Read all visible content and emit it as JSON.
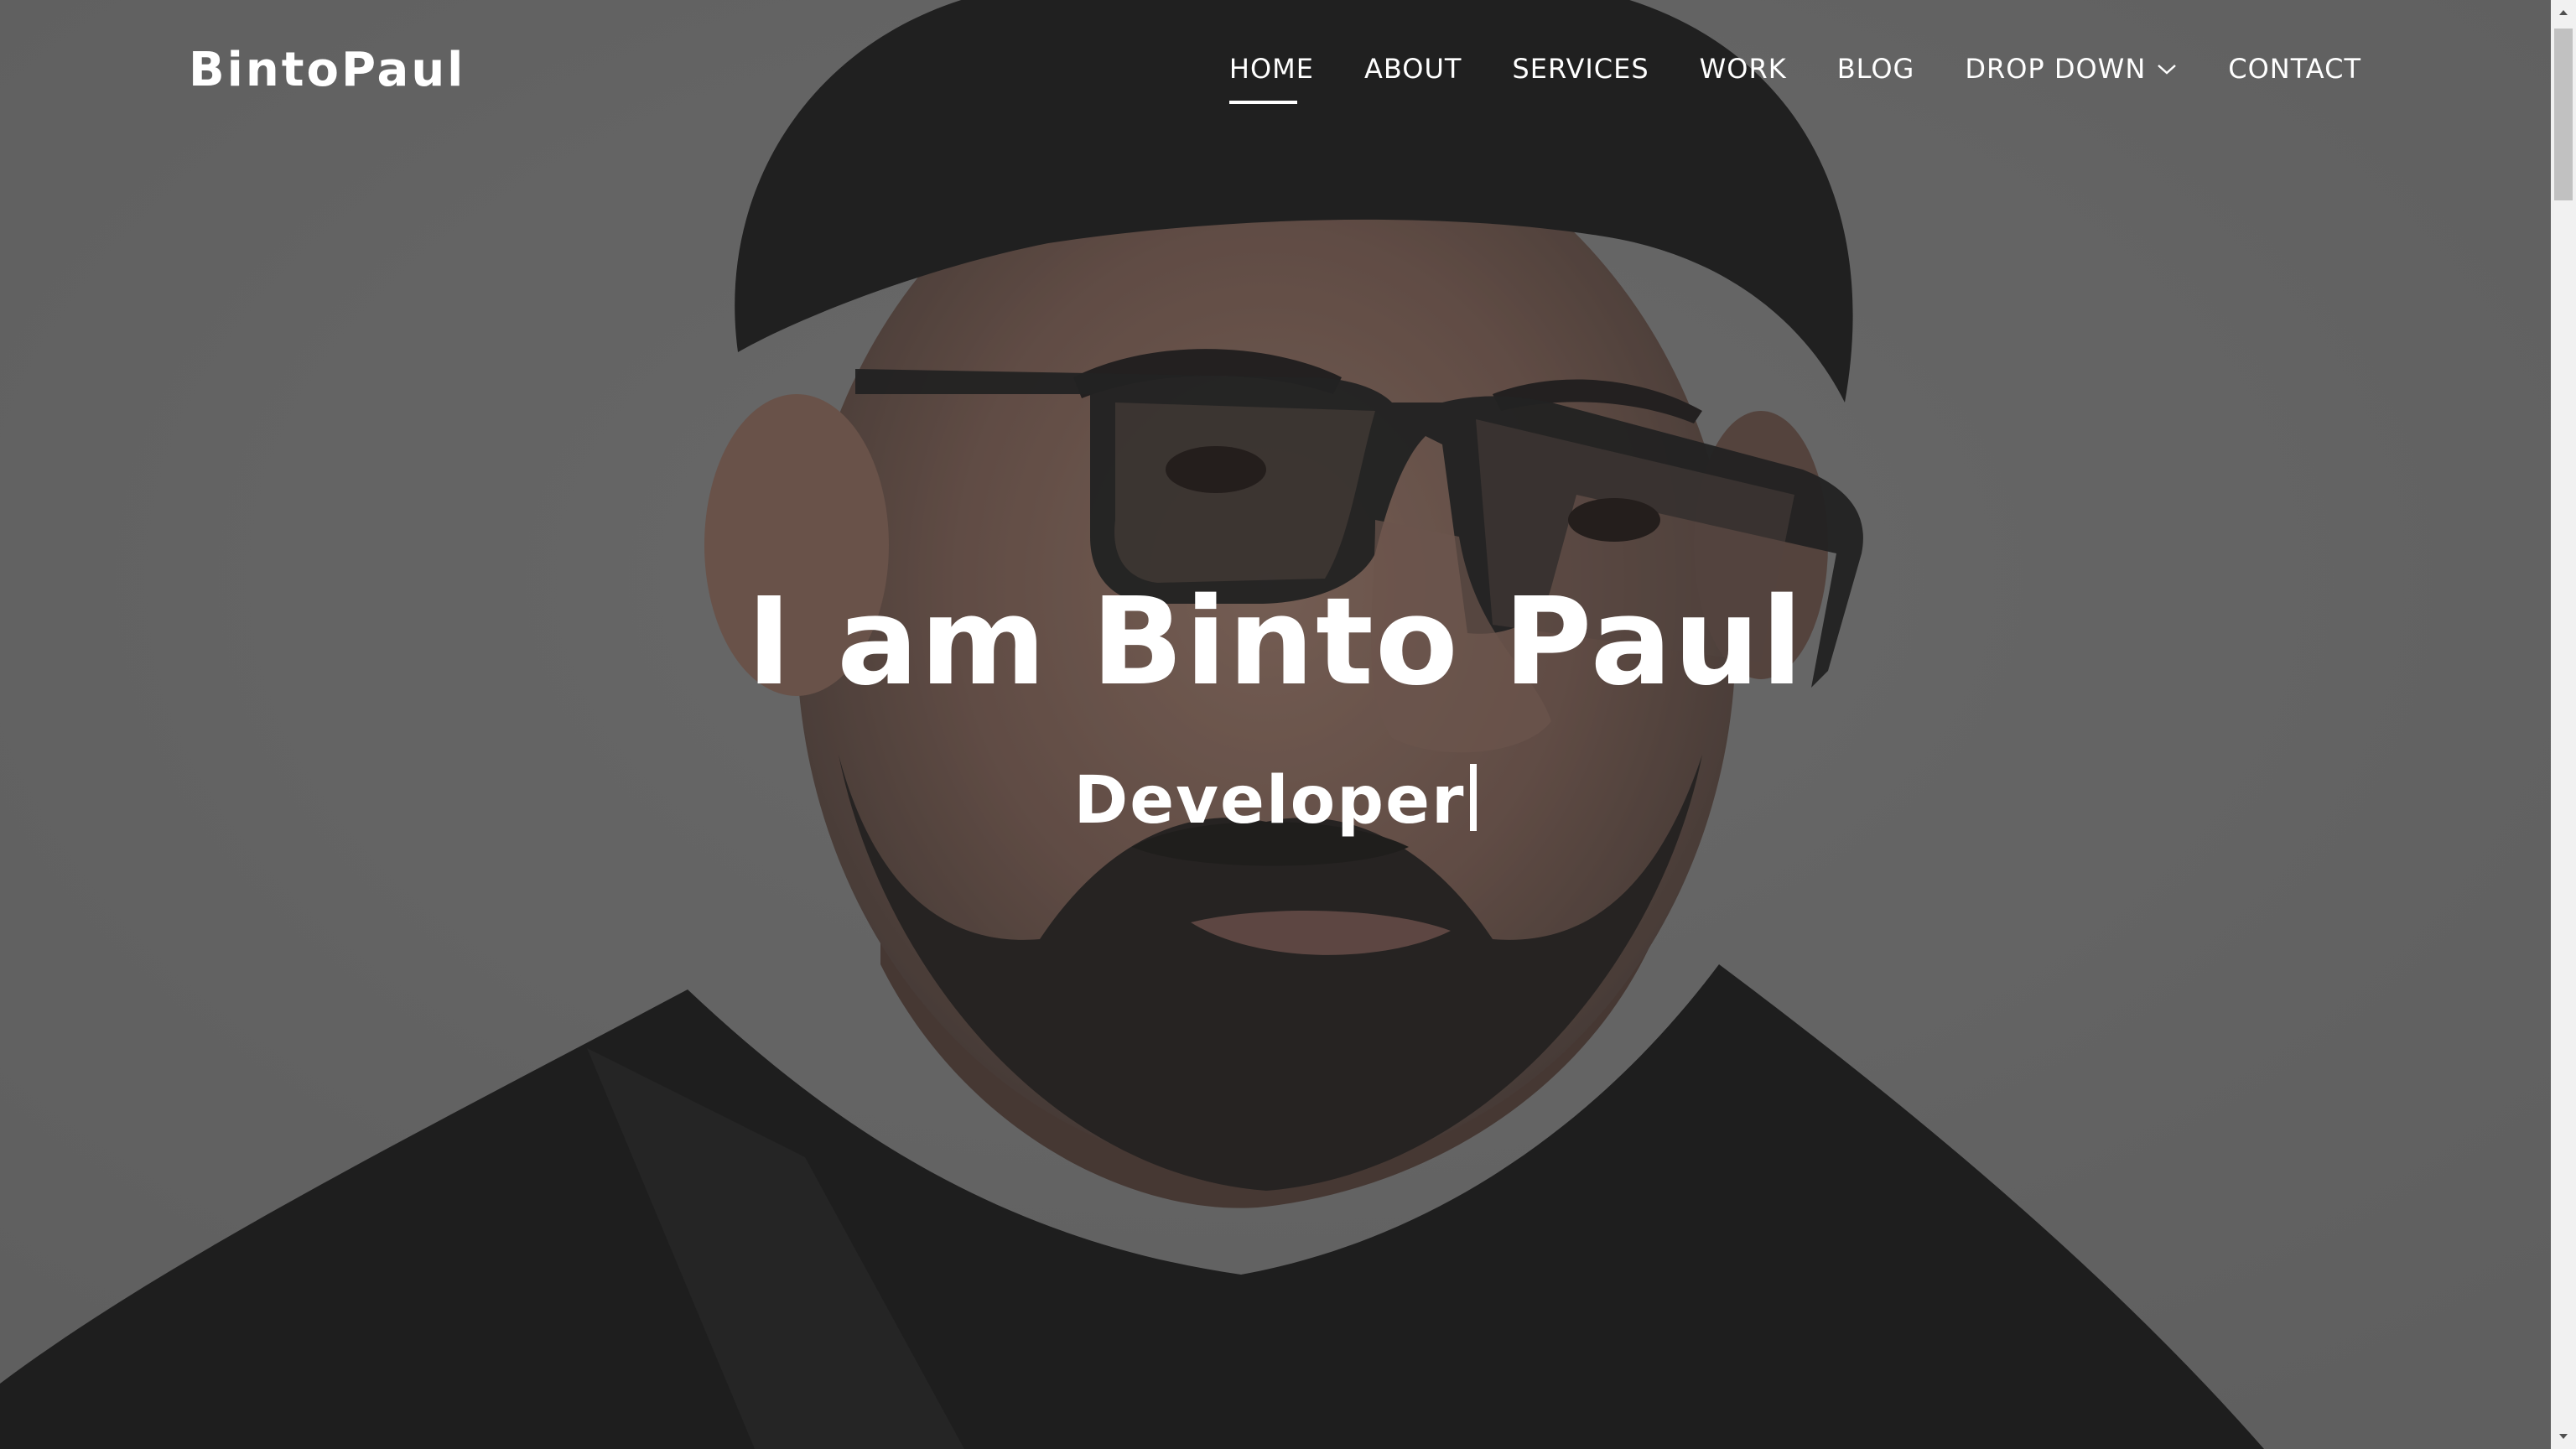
{
  "header": {
    "logo": "BintoPaul",
    "nav": [
      {
        "label": "HOME",
        "active": true
      },
      {
        "label": "ABOUT"
      },
      {
        "label": "SERVICES"
      },
      {
        "label": "WORK"
      },
      {
        "label": "BLOG"
      },
      {
        "label": "DROP DOWN",
        "icon": "chevron-down-icon"
      },
      {
        "label": "CONTACT"
      }
    ]
  },
  "hero": {
    "title": "I am Binto Paul",
    "subtitle": "Developer"
  },
  "colors": {
    "text": "#ffffff",
    "overlay": "#747474"
  }
}
